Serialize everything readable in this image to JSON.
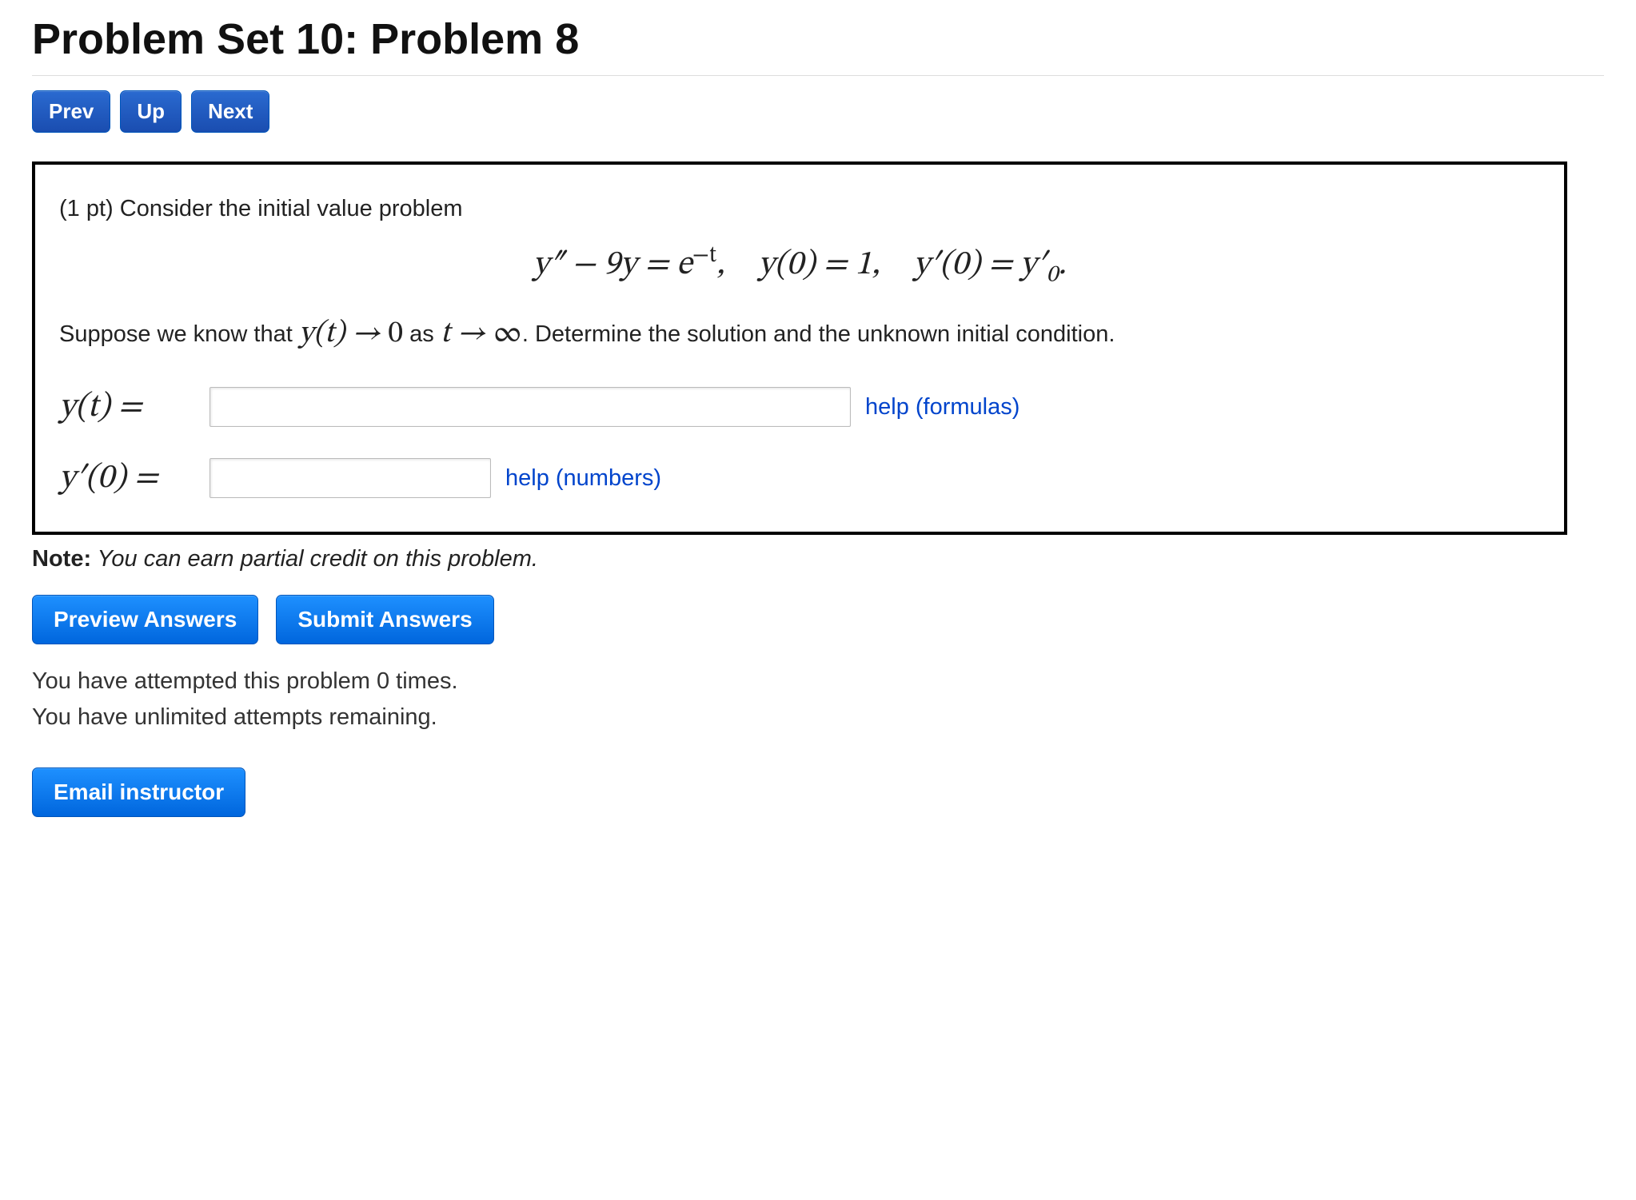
{
  "title": "Problem Set 10: Problem 8",
  "nav": {
    "prev": "Prev",
    "up": "Up",
    "next": "Next"
  },
  "problem": {
    "points_prefix": "(1 pt) ",
    "intro": "Consider the initial value problem",
    "equation_html": "y″ − 9y = e<span class='sup'>−t</span>,<span class='eq-gap'></span>y<span class='up'>(0)</span> = 1,<span class='eq-gap'></span>y′<span class='up'>(0)</span> = y′<span class='sub'>0</span>.",
    "cond_pre": "Suppose we know that ",
    "cond_math1": "y(t) → <span class='up'>0</span>",
    "cond_mid": " as ",
    "cond_math2": "t → <span class='up'>∞</span>",
    "cond_post": ". Determine the solution and the unknown initial condition.",
    "fields": {
      "yt_label": "y(t) =",
      "yt_help": "help (formulas)",
      "yprime_label": "y′(0) =",
      "yprime_help": "help (numbers)"
    }
  },
  "note_bold": "Note:",
  "note_text": " You can earn partial credit on this problem.",
  "actions": {
    "preview": "Preview Answers",
    "submit": "Submit Answers"
  },
  "status": {
    "attempts": "You have attempted this problem 0 times.",
    "remaining": "You have unlimited attempts remaining."
  },
  "email": "Email instructor"
}
